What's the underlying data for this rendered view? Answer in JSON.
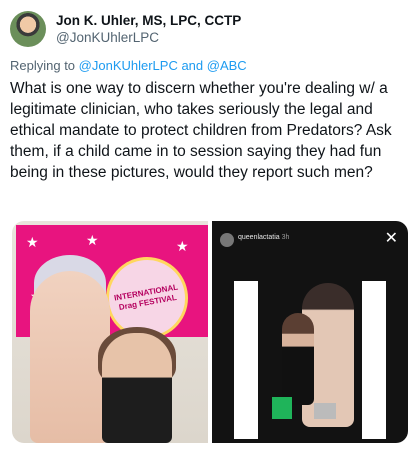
{
  "user": {
    "display_name": "Jon K. Uhler, MS, LPC, CCTP",
    "handle": "@JonKUhlerLPC"
  },
  "reply": {
    "prefix": "Replying to ",
    "to1": "@JonKUhlerLPC",
    "and": " and ",
    "to2": "@ABC"
  },
  "tweet": {
    "text": "What is one way to discern whether you're dealing w/ a legitimate clinician, who takes seriously the legal and ethical mandate to protect children from Predators? Ask them, if a child came in to session saying they had fun being in these pictures, would they report such men?"
  },
  "media": {
    "left": {
      "banner_text": "INTERNATIONAL Drag FESTIVAL"
    },
    "right": {
      "ig_username": "queenlactatia",
      "ig_time": "3h",
      "close_icon": "close-icon"
    }
  },
  "colors": {
    "link": "#1d9bf0",
    "secondary_text": "#536471",
    "banner_pink": "#e8147f"
  }
}
